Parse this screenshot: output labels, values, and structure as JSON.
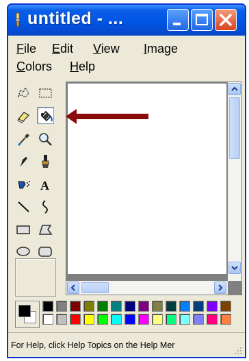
{
  "window": {
    "title": "untitled - ...",
    "app_icon": "paint-brush-icon",
    "buttons": [
      "minimize-icon",
      "maximize-icon",
      "close-icon"
    ]
  },
  "menu": {
    "rows": [
      [
        {
          "acc": "F",
          "rest": "ile"
        },
        {
          "acc": "E",
          "rest": "dit"
        },
        {
          "acc": "V",
          "rest": "iew"
        },
        {
          "acc": "I",
          "rest": "mage"
        }
      ],
      [
        {
          "acc": "C",
          "rest": "olors"
        },
        {
          "acc": "H",
          "rest": "elp"
        }
      ]
    ]
  },
  "tools": [
    {
      "name": "free-form-select-icon",
      "selected": false
    },
    {
      "name": "select-icon",
      "selected": false
    },
    {
      "name": "eraser-icon",
      "selected": false
    },
    {
      "name": "fill-with-color-icon",
      "selected": true
    },
    {
      "name": "pick-color-icon",
      "selected": false
    },
    {
      "name": "magnifier-icon",
      "selected": false
    },
    {
      "name": "pencil-icon",
      "selected": false
    },
    {
      "name": "brush-icon",
      "selected": false
    },
    {
      "name": "airbrush-icon",
      "selected": false
    },
    {
      "name": "text-icon",
      "selected": false
    },
    {
      "name": "line-icon",
      "selected": false
    },
    {
      "name": "curve-icon",
      "selected": false
    },
    {
      "name": "rectangle-icon",
      "selected": false
    },
    {
      "name": "polygon-icon",
      "selected": false
    },
    {
      "name": "ellipse-icon",
      "selected": false
    },
    {
      "name": "rounded-rectangle-icon",
      "selected": false
    }
  ],
  "text_tool_glyph": "A",
  "palette": {
    "foreground": "#000000",
    "background": "#ffffff",
    "colors_top": [
      "#000000",
      "#808080",
      "#800000",
      "#808000",
      "#008000",
      "#008080",
      "#000080",
      "#800080",
      "#808040",
      "#004040",
      "#0080ff",
      "#004080",
      "#8000ff",
      "#804000"
    ],
    "colors_bottom": [
      "#ffffff",
      "#c0c0c0",
      "#ff0000",
      "#ffff00",
      "#00ff00",
      "#00ffff",
      "#0000ff",
      "#ff00ff",
      "#ffff80",
      "#00ff80",
      "#80ffff",
      "#8080ff",
      "#ff0080",
      "#ff8040"
    ]
  },
  "status": {
    "text": "For Help, click Help Topics on the Help Mer"
  },
  "accent_colors": {
    "titlebar": "#0055e5",
    "arrow": "#8b0a0a"
  }
}
